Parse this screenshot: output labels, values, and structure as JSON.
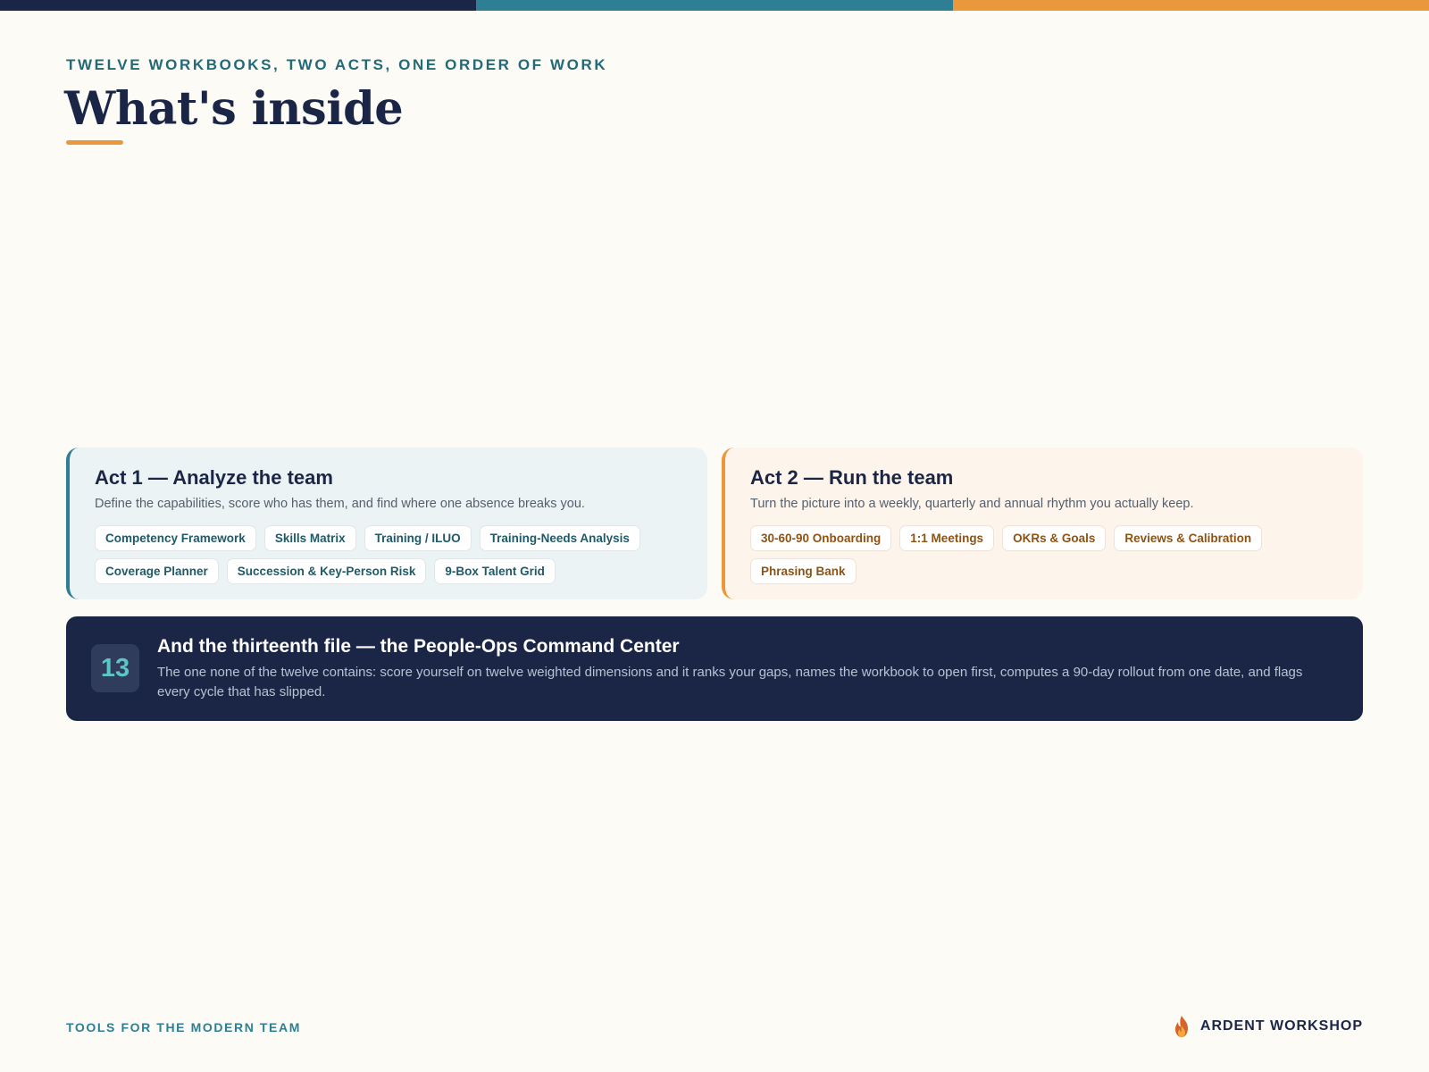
{
  "colors": {
    "navy": "#1b2647",
    "teal": "#2e7f93",
    "orange": "#eb983c",
    "background": "#fcfbf6"
  },
  "header": {
    "eyebrow": "TWELVE WORKBOOKS, TWO ACTS, ONE ORDER OF WORK",
    "title": "What's inside"
  },
  "acts": [
    {
      "title": "Act 1 — Analyze the team",
      "description": "Define the capabilities, score who has them, and find where one absence breaks you.",
      "chips": [
        "Competency Framework",
        "Skills Matrix",
        "Training / ILUO",
        "Training-Needs Analysis",
        "Coverage Planner",
        "Succession & Key-Person Risk",
        "9-Box Talent Grid"
      ]
    },
    {
      "title": "Act 2 — Run the team",
      "description": "Turn the picture into a weekly, quarterly and annual rhythm you actually keep.",
      "chips": [
        "30-60-90 Onboarding",
        "1:1 Meetings",
        "OKRs & Goals",
        "Reviews & Calibration",
        "Phrasing Bank"
      ]
    }
  ],
  "command_center": {
    "number": "13",
    "title": "And the thirteenth file — the People-Ops Command Center",
    "description": "The one none of the twelve contains: score yourself on twelve weighted dimensions and it ranks your gaps, names the workbook to open first, computes a 90-day rollout from one date, and flags every cycle that has slipped."
  },
  "footer": {
    "tagline": "TOOLS FOR THE MODERN TEAM",
    "brand": "ARDENT WORKSHOP",
    "brand_icon": "flame-icon"
  }
}
